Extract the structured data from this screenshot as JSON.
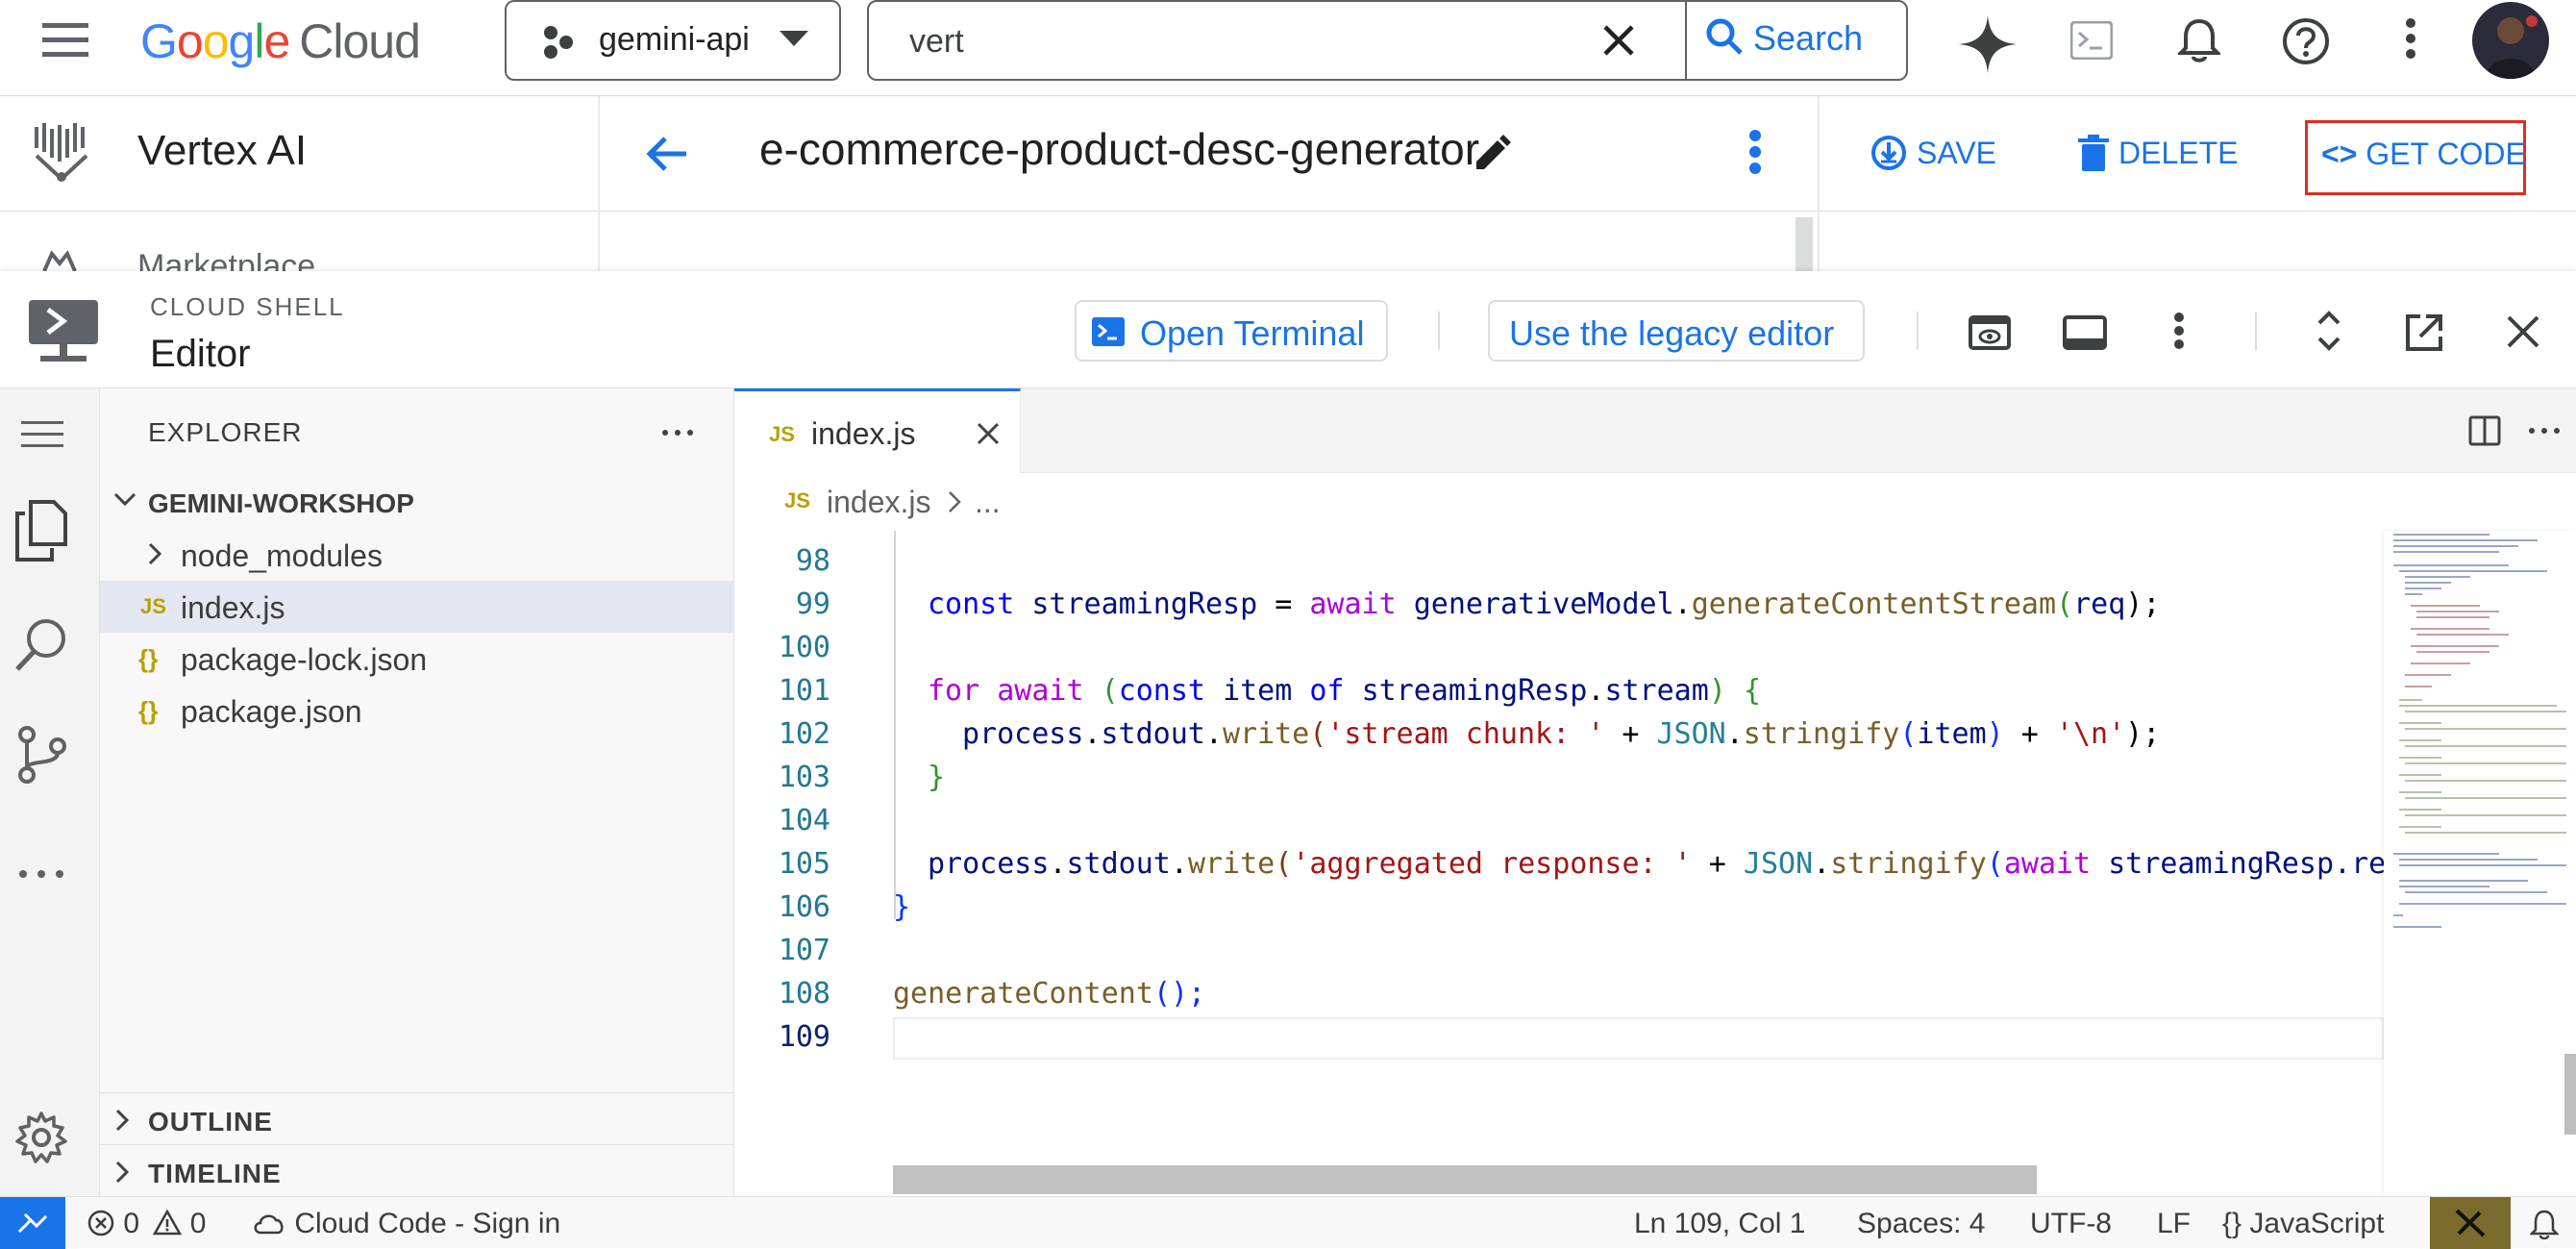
{
  "gcp_header": {
    "logo_google": "Google",
    "logo_cloud": "Cloud",
    "project_name": "gemini-api",
    "search_value": "vert",
    "search_button": "Search"
  },
  "vertex_bar": {
    "product_title": "Vertex AI",
    "next_nav_item": "Marketplace",
    "prompt_title": "e-commerce-product-desc-generator",
    "save_label": "SAVE",
    "delete_label": "DELETE",
    "get_code_label": "GET CODE"
  },
  "cloud_shell": {
    "small_title": "CLOUD SHELL",
    "big_title": "Editor",
    "open_terminal_label": "Open Terminal",
    "legacy_editor_label": "Use the legacy editor"
  },
  "explorer": {
    "header": "EXPLORER",
    "folder": "GEMINI-WORKSHOP",
    "items": [
      {
        "label": "node_modules",
        "kind": "folder"
      },
      {
        "label": "index.js",
        "kind": "js",
        "badge": "JS"
      },
      {
        "label": "package-lock.json",
        "kind": "json",
        "badge": "{}"
      },
      {
        "label": "package.json",
        "kind": "json",
        "badge": "{}"
      }
    ],
    "outline": "OUTLINE",
    "timeline": "TIMELINE"
  },
  "editor": {
    "tab_label": "index.js",
    "tab_badge": "JS",
    "breadcrumb_file": "index.js",
    "breadcrumb_more": "...",
    "line_numbers": [
      "98",
      "99",
      "100",
      "101",
      "102",
      "103",
      "104",
      "105",
      "106",
      "107",
      "108",
      "109"
    ],
    "code": {
      "l99_const": "const",
      "l99_var": "streamingResp",
      "l99_eq": " = ",
      "l99_await": "await",
      "l99_obj": "generativeModel",
      "l99_dot": ".",
      "l99_fn": "generateContentStream",
      "l99_p1": "(",
      "l99_arg": "req",
      "l99_p2": ");",
      "l101_for": "for",
      "l101_await": "await",
      "l101_p1": "(",
      "l101_const": "const",
      "l101_item": "item",
      "l101_of": "of",
      "l101_sr": "streamingResp",
      "l101_dot": ".",
      "l101_stream": "stream",
      "l101_p2": ")",
      "l101_brace": "{",
      "l102_process": "process",
      "l102_d1": ".",
      "l102_stdout": "stdout",
      "l102_d2": ".",
      "l102_write": "write",
      "l102_p1": "(",
      "l102_str1": "'stream chunk: '",
      "l102_plus1": " + ",
      "l102_json": "JSON",
      "l102_d3": ".",
      "l102_stringify": "stringify",
      "l102_p2": "(",
      "l102_item": "item",
      "l102_p3": ")",
      "l102_plus2": " + ",
      "l102_str2": "'\\n'",
      "l102_p4": ");",
      "l103_brace": "}",
      "l105_process": "process",
      "l105_d1": ".",
      "l105_stdout": "stdout",
      "l105_d2": ".",
      "l105_write": "write",
      "l105_p1": "(",
      "l105_str": "'aggregated response: '",
      "l105_plus": " + ",
      "l105_json": "JSON",
      "l105_d3": ".",
      "l105_stringify": "stringify",
      "l105_p2": "(",
      "l105_await": "await",
      "l105_sr": "streamingResp",
      "l105_rest": ".re",
      "l106_brace": "}",
      "l108_fn": "generateContent",
      "l108_p": "();"
    }
  },
  "statusbar": {
    "errors": "0",
    "warnings": "0",
    "cloud_code": "Cloud Code - Sign in",
    "position": "Ln 109, Col 1",
    "spaces": "Spaces: 4",
    "encoding": "UTF-8",
    "eol": "LF",
    "lang_braces": "{}",
    "language": "JavaScript"
  },
  "colors": {
    "accent": "#1a73e8",
    "get_code_border": "#d93025"
  }
}
